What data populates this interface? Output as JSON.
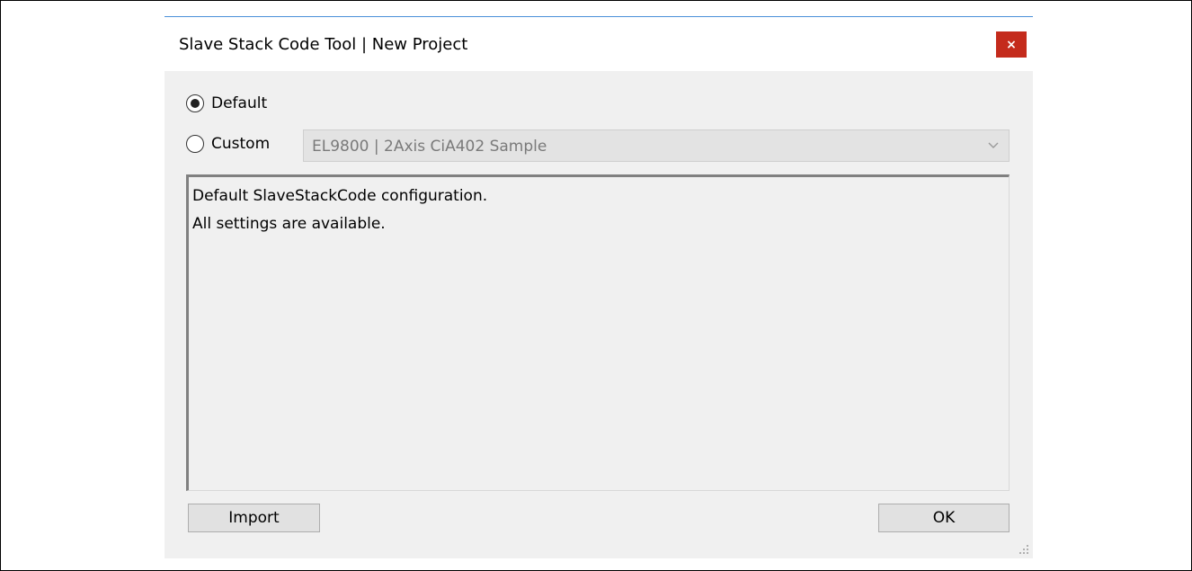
{
  "window": {
    "title": "Slave Stack Code Tool | New Project",
    "close_label": "×"
  },
  "options": {
    "default_label": "Default",
    "custom_label": "Custom",
    "selected": "Default"
  },
  "custom_select": {
    "value": "EL9800 | 2Axis CiA402 Sample"
  },
  "description": {
    "lines": [
      "Default SlaveStackCode configuration.",
      "All settings are available."
    ]
  },
  "buttons": {
    "import_label": "Import",
    "ok_label": "OK"
  },
  "icons": {
    "close": "close-icon",
    "dropdown": "chevron-down-icon",
    "resize": "resize-grip-icon"
  },
  "colors": {
    "close_button": "#c42b1c",
    "title_accent": "#4a90d9",
    "dialog_background": "#f0f0f0"
  }
}
